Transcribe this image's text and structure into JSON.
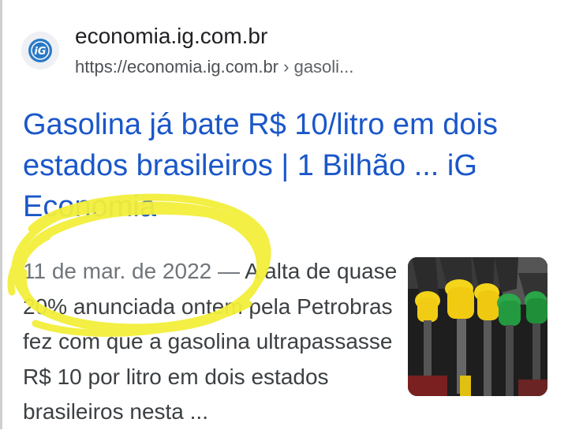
{
  "result": {
    "site_name": "economia.ig.com.br",
    "url": "https://economia.ig.com.br",
    "url_crumb": "› gasoli...",
    "favicon": "ig-logo-icon",
    "title": "Gasolina já bate R$ 10/litro em dois estados brasileiros | 1 Bilhão ... iG Economia",
    "date": "11 de mar. de 2022",
    "separator": " — ",
    "snippet": "A alta de quase 20% anunciada ontem pela Petrobras fez com que a gasolina ultrapassasse R$ 10 por litro em dois estados brasileiros nesta ...",
    "thumbnail": "fuel-nozzles-image"
  },
  "colors": {
    "title": "#1a57c9",
    "highlight": "#f3ef3a",
    "text": "#3c4043"
  }
}
